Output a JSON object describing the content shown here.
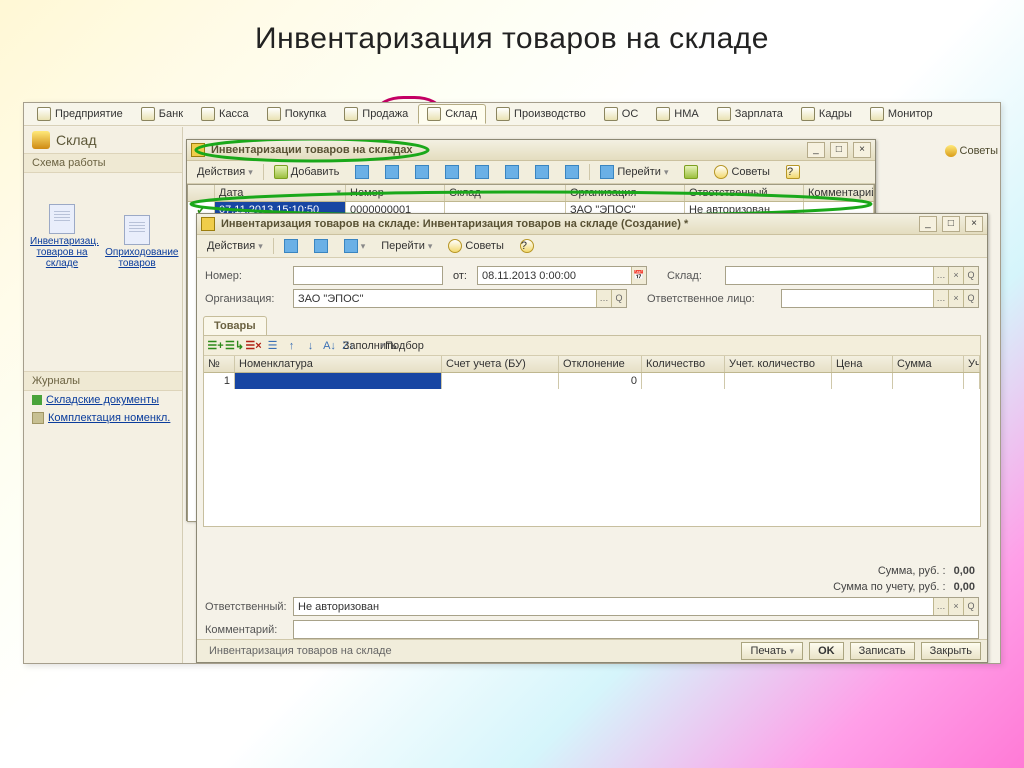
{
  "slide": {
    "title": "Инвентаризация товаров на складе"
  },
  "tabs": [
    {
      "label": "Предприятие"
    },
    {
      "label": "Банк"
    },
    {
      "label": "Касса"
    },
    {
      "label": "Покупка"
    },
    {
      "label": "Продажа"
    },
    {
      "label": "Склад",
      "active": true
    },
    {
      "label": "Производство"
    },
    {
      "label": "ОС"
    },
    {
      "label": "НМА"
    },
    {
      "label": "Зарплата"
    },
    {
      "label": "Кадры"
    },
    {
      "label": "Монитор"
    }
  ],
  "leftpane": {
    "title": "Склад",
    "section_scheme": "Схема работы",
    "nodes": [
      {
        "label": "Инвентаризац. товаров на складе"
      },
      {
        "label": "Оприходование товаров"
      }
    ],
    "section_journals": "Журналы",
    "journal_links": [
      {
        "label": "Складские документы"
      },
      {
        "label": "Комплектация номенкл."
      }
    ]
  },
  "advice": "Советы",
  "list_win": {
    "title": "Инвентаризации товаров на складах",
    "toolbar": {
      "actions": "Действия",
      "add": "Добавить",
      "goto": "Перейти",
      "tips": "Советы"
    },
    "columns": [
      "",
      "Дата",
      "Номер",
      "Склад",
      "Организация",
      "Ответственный",
      "Комментарий"
    ],
    "row": {
      "date": "07.11.2013 15:10:50",
      "number": "0000000001",
      "sklad": "",
      "org": "ЗАО \"ЭПОС\"",
      "resp": "Не авторизован",
      "comment": ""
    }
  },
  "doc_win": {
    "title": "Инвентаризация товаров на складе: Инвентаризация товаров на складе (Создание) *",
    "toolbar": {
      "actions": "Действия",
      "goto": "Перейти",
      "tips": "Советы"
    },
    "fields": {
      "num_label": "Номер:",
      "date_label": "от:",
      "date": "08.11.2013  0:00:00",
      "sklad_label": "Склад:",
      "org_label": "Организация:",
      "org": "ЗАО \"ЭПОС\"",
      "resp_label": "Ответственное лицо:"
    },
    "items": {
      "tab": "Товары",
      "fill": "Заполнить",
      "pick": "Подбор",
      "columns": [
        "№",
        "Номенклатура",
        "Счет учета (БУ)",
        "Отклонение",
        "Количество",
        "Учет. количество",
        "Цена",
        "Сумма",
        "Учет. сумма"
      ],
      "row": {
        "n": "1",
        "deviation": "0"
      }
    },
    "totals": {
      "sum_label": "Сумма, руб. :",
      "sum": "0,00",
      "sum_acc_label": "Сумма по учету, руб. :",
      "sum_acc": "0,00"
    },
    "footer": {
      "resp_label": "Ответственный:",
      "resp": "Не авторизован",
      "comment_label": "Комментарий:"
    },
    "status": {
      "doc": "Инвентаризация товаров на складе",
      "print": "Печать",
      "ok": "OK",
      "save": "Записать",
      "close": "Закрыть"
    }
  }
}
